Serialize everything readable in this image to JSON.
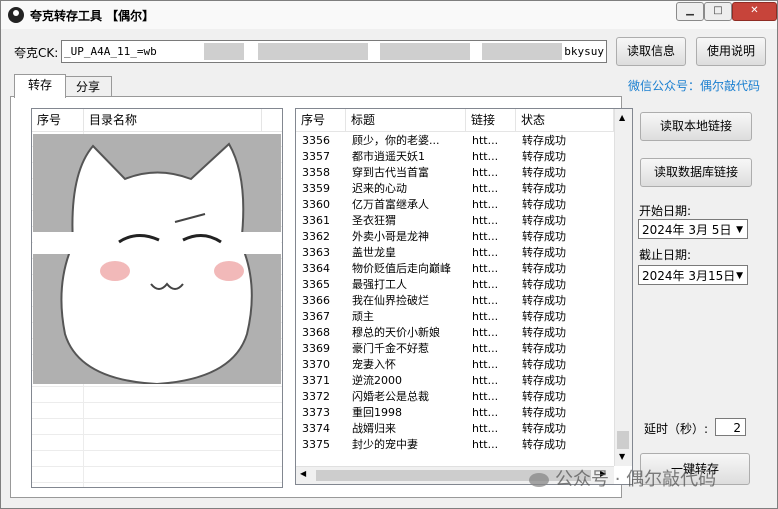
{
  "window": {
    "title": "夸克转存工具 【偶尔】",
    "min_label": "▁",
    "max_label": "□",
    "close_label": "✕"
  },
  "ck": {
    "label": "夸克CK:",
    "value_start": "_UP_A4A_11_=wb",
    "value_end": "bkysuy"
  },
  "buttons": {
    "read_info": "读取信息",
    "help": "使用说明",
    "read_local": "读取本地链接",
    "read_db": "读取数据库链接",
    "one_click": "一键转存"
  },
  "tabs": [
    {
      "label": "转存",
      "active": true
    },
    {
      "label": "分享",
      "active": false
    }
  ],
  "wechat_label": "微信公众号：偶尔敲代码",
  "left_table": {
    "columns": [
      "序号",
      "目录名称"
    ]
  },
  "right_table": {
    "columns": [
      "序号",
      "标题",
      "链接",
      "状态"
    ],
    "rows": [
      {
        "id": "3356",
        "title": "顾少，你的老婆...",
        "link": "htt...",
        "status": "转存成功"
      },
      {
        "id": "3357",
        "title": "都市逍遥天妖1",
        "link": "htt...",
        "status": "转存成功"
      },
      {
        "id": "3358",
        "title": "穿到古代当首富",
        "link": "htt...",
        "status": "转存成功"
      },
      {
        "id": "3359",
        "title": "迟来的心动",
        "link": "htt...",
        "status": "转存成功"
      },
      {
        "id": "3360",
        "title": "亿万首富继承人",
        "link": "htt...",
        "status": "转存成功"
      },
      {
        "id": "3361",
        "title": "圣衣狂猬",
        "link": "htt...",
        "status": "转存成功"
      },
      {
        "id": "3362",
        "title": "外卖小哥是龙神",
        "link": "htt...",
        "status": "转存成功"
      },
      {
        "id": "3363",
        "title": "盖世龙皇",
        "link": "htt...",
        "status": "转存成功"
      },
      {
        "id": "3364",
        "title": "物价贬值后走向巅峰",
        "link": "htt...",
        "status": "转存成功"
      },
      {
        "id": "3365",
        "title": "最强打工人",
        "link": "htt...",
        "status": "转存成功"
      },
      {
        "id": "3366",
        "title": "我在仙界捡破烂",
        "link": "htt...",
        "status": "转存成功"
      },
      {
        "id": "3367",
        "title": "顽主",
        "link": "htt...",
        "status": "转存成功"
      },
      {
        "id": "3368",
        "title": "穆总的天价小新娘",
        "link": "htt...",
        "status": "转存成功"
      },
      {
        "id": "3369",
        "title": "豪门千金不好惹",
        "link": "htt...",
        "status": "转存成功"
      },
      {
        "id": "3370",
        "title": "宠妻入怀",
        "link": "htt...",
        "status": "转存成功"
      },
      {
        "id": "3371",
        "title": "逆流2000",
        "link": "htt...",
        "status": "转存成功"
      },
      {
        "id": "3372",
        "title": "闪婚老公是总裁",
        "link": "htt...",
        "status": "转存成功"
      },
      {
        "id": "3373",
        "title": "重回1998",
        "link": "htt...",
        "status": "转存成功"
      },
      {
        "id": "3374",
        "title": "战婿归来",
        "link": "htt...",
        "status": "转存成功"
      },
      {
        "id": "3375",
        "title": "封少的宠中妻",
        "link": "htt...",
        "status": "转存成功"
      }
    ]
  },
  "start_date": {
    "label": "开始日期:",
    "value": "2024年 3月 5日"
  },
  "end_date": {
    "label": "截止日期:",
    "value": "2024年 3月15日"
  },
  "delay": {
    "label": "延时（秒）:",
    "value": "2"
  },
  "watermark": "公众号 · 偶尔敲代码",
  "icons": {
    "app": "quark-app-icon",
    "dropdown": "chevron-down-icon",
    "scroll_up": "triangle-up-icon",
    "scroll_down": "triangle-down-icon",
    "scroll_left": "triangle-left-icon",
    "scroll_right": "triangle-right-icon",
    "wechat": "wechat-icon"
  }
}
